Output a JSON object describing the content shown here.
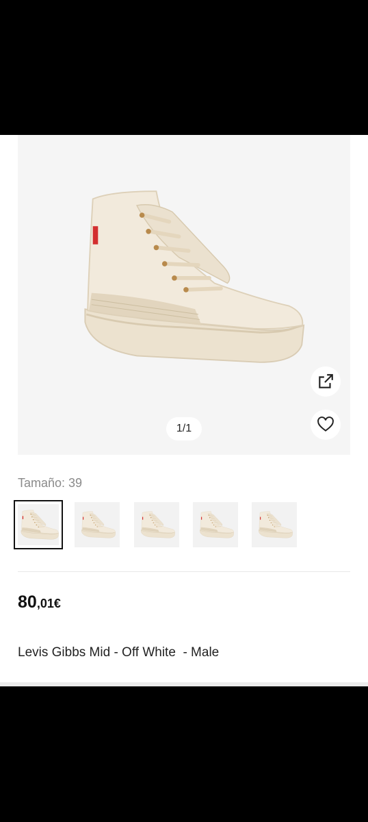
{
  "gallery": {
    "counter": "1/1",
    "expand_icon": "external-link-icon",
    "wishlist_icon": "heart-icon",
    "product_image_alt": "Levis Gibbs Mid - Off White sneaker"
  },
  "size": {
    "label": "Tamaño: 39",
    "thumbnails": [
      "shoe-thumbnail-1",
      "shoe-thumbnail-2",
      "shoe-thumbnail-3",
      "shoe-thumbnail-4",
      "shoe-thumbnail-5"
    ],
    "selected_index": 0
  },
  "product": {
    "price_integer": "80",
    "price_decimal": ",01€",
    "title": "Levis Gibbs Mid - Off White  - Male"
  },
  "colors": {
    "product_color": "#efe6d6",
    "background": "#f5f5f5",
    "text": "#111111",
    "muted": "#8a8a8a",
    "tab_red": "#d32f2f"
  }
}
